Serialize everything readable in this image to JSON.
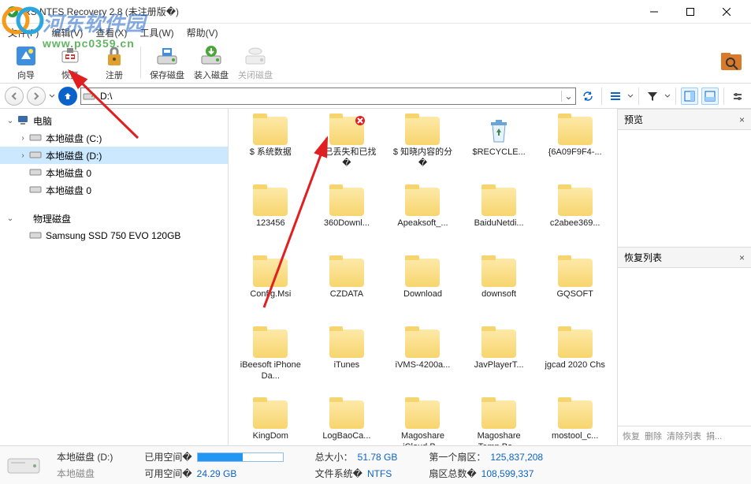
{
  "watermark": {
    "text": "河东软件园",
    "url": "www.pc0359.cn"
  },
  "title": "RS NTFS Recovery 2.8 (未注册版�)",
  "menu": [
    "文件(F)",
    "编辑(V)",
    "查看(X)",
    "工具(W)",
    "帮助(V)"
  ],
  "toolbar": {
    "wizard": "向导",
    "recover": "恢复",
    "register": "注册",
    "save_disk": "保存磁盘",
    "mount_disk": "装入磁盘",
    "close_disk": "关闭磁盘"
  },
  "address": {
    "path": "D:\\"
  },
  "tree": {
    "computer": "电脑",
    "drive_c": "本地磁盘 (C:)",
    "drive_d": "本地磁盘 (D:)",
    "drive_0a": "本地磁盘 0",
    "drive_0b": "本地磁盘 0",
    "physical": "物理磁盘",
    "ssd": "Samsung SSD 750 EVO 120GB"
  },
  "files": [
    "$ 系统数据",
    "$ 已丢失和已找�",
    "$ 知晓内容的分�",
    "$RECYCLE...",
    "{6A09F9F4-...",
    "123456",
    "360Downl...",
    "Apeaksoft_...",
    "BaiduNetdi...",
    "c2abee369...",
    "Config.Msi",
    "CZDATA",
    "Download",
    "downsoft",
    "GQSOFT",
    "iBeesoft iPhone Da...",
    "iTunes",
    "iVMS-4200a...",
    "JavPlayerT...",
    "jgcad 2020 Chs",
    "KingDom",
    "LogBaoCa...",
    "Magoshare iCloud B...",
    "Magoshare Temp Ba...",
    "mostool_c..."
  ],
  "panels": {
    "preview": "预览",
    "recover_list": "恢复列表",
    "recover_foot": {
      "recover": "恢复",
      "delete": "删除",
      "clear": "清除列表",
      "donate": "捐..."
    }
  },
  "status": {
    "drive_label": "本地磁盘 (D:)",
    "drive_sub": "本地磁盘",
    "used_label": "已用空间�",
    "free_label": "可用空间�",
    "free_value": "24.29 GB",
    "total_label": "总大小：",
    "total_value": "51.78 GB",
    "fs_label": "文件系统�",
    "fs_value": "NTFS",
    "first_sector_label": "第一个扇区：",
    "first_sector_value": "125,837,208",
    "total_sectors_label": "扇区总数�",
    "total_sectors_value": "108,599,337",
    "used_pct": 53
  }
}
